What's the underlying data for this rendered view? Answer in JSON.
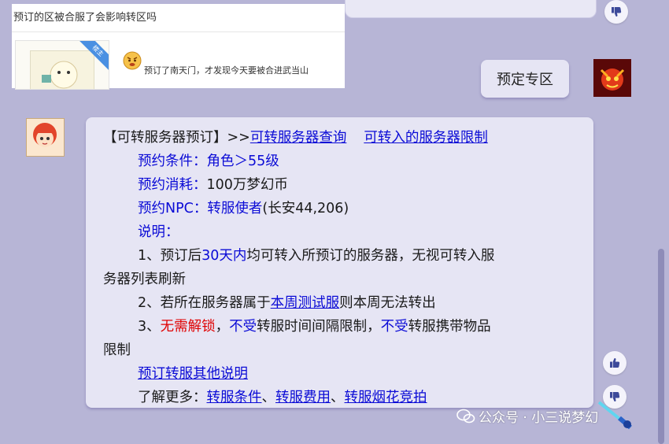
{
  "overlay": {
    "title": "预订的区被合服了会影响转区吗",
    "badge": "楼主",
    "reply": "预订了南天门，才发现今天要被合进武当山"
  },
  "user_message": "预定专区",
  "bot": {
    "l1_prefix": "【可转服务器预订】>>",
    "l1_link1": "可转服务器查询",
    "l1_link2": "可转入的服务器限制",
    "l2_label": "预约条件：",
    "l2_value": "角色＞55级",
    "l3_label": "预约消耗：",
    "l3_value": "100万梦幻币",
    "l4_label": "预约NPC：",
    "l4_value": "转服使者",
    "l4_suffix": "(长安44,206)",
    "l5": "说明：",
    "l6_a": "1、预订后",
    "l6_hl": "30天内",
    "l6_b": "均可转入所预订的服务器，无视可转入服",
    "l7": "务器列表刷新",
    "l8_a": "2、若所在服务器属于",
    "l8_link": "本周测试服",
    "l8_b": "则本周无法转出",
    "l9_a": "3、",
    "l9_red": "无需解锁",
    "l9_b": "，",
    "l9_hl1": "不受",
    "l9_c": "转服时间间隔限制，",
    "l9_hl2": "不受",
    "l9_d": "转服携带物品",
    "l10": "限制",
    "l11_link": "预订转服其他说明",
    "l12_a": "了解更多：",
    "l12_link1": "转服条件",
    "l12_sep1": "、",
    "l12_link2": "转服费用",
    "l12_sep2": "、",
    "l12_link3": "转服烟花竞拍"
  },
  "watermark": "公众号 · 小三说梦幻",
  "icons": {
    "thumb_down": "thumbs-down-icon",
    "thumb_up": "thumbs-up-icon"
  },
  "colors": {
    "background": "#b7b5d6",
    "bubble": "#e6e5f4",
    "link": "#0b0bd6",
    "highlight_red": "#e00000",
    "thumb_icon": "#3d4a9a"
  }
}
